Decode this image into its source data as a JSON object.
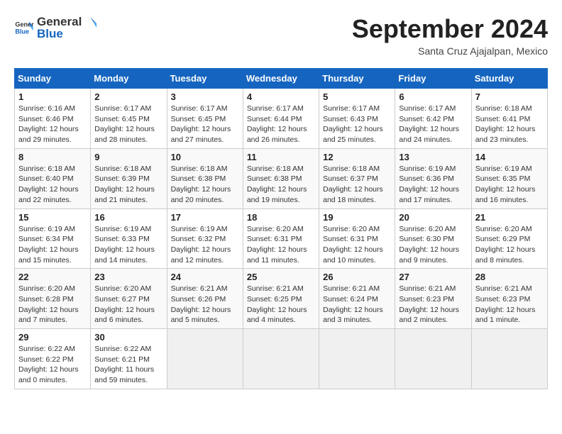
{
  "header": {
    "logo_general": "General",
    "logo_blue": "Blue",
    "month_title": "September 2024",
    "location": "Santa Cruz Ajajalpan, Mexico"
  },
  "calendar": {
    "days_of_week": [
      "Sunday",
      "Monday",
      "Tuesday",
      "Wednesday",
      "Thursday",
      "Friday",
      "Saturday"
    ],
    "weeks": [
      [
        {
          "day": "",
          "empty": true
        },
        {
          "day": "",
          "empty": true
        },
        {
          "day": "",
          "empty": true
        },
        {
          "day": "",
          "empty": true
        },
        {
          "day": "",
          "empty": true
        },
        {
          "day": "",
          "empty": true
        },
        {
          "day": "",
          "empty": true
        }
      ],
      [
        {
          "day": "1",
          "sunrise": "Sunrise: 6:16 AM",
          "sunset": "Sunset: 6:46 PM",
          "daylight": "Daylight: 12 hours and 29 minutes."
        },
        {
          "day": "2",
          "sunrise": "Sunrise: 6:17 AM",
          "sunset": "Sunset: 6:45 PM",
          "daylight": "Daylight: 12 hours and 28 minutes."
        },
        {
          "day": "3",
          "sunrise": "Sunrise: 6:17 AM",
          "sunset": "Sunset: 6:45 PM",
          "daylight": "Daylight: 12 hours and 27 minutes."
        },
        {
          "day": "4",
          "sunrise": "Sunrise: 6:17 AM",
          "sunset": "Sunset: 6:44 PM",
          "daylight": "Daylight: 12 hours and 26 minutes."
        },
        {
          "day": "5",
          "sunrise": "Sunrise: 6:17 AM",
          "sunset": "Sunset: 6:43 PM",
          "daylight": "Daylight: 12 hours and 25 minutes."
        },
        {
          "day": "6",
          "sunrise": "Sunrise: 6:17 AM",
          "sunset": "Sunset: 6:42 PM",
          "daylight": "Daylight: 12 hours and 24 minutes."
        },
        {
          "day": "7",
          "sunrise": "Sunrise: 6:18 AM",
          "sunset": "Sunset: 6:41 PM",
          "daylight": "Daylight: 12 hours and 23 minutes."
        }
      ],
      [
        {
          "day": "8",
          "sunrise": "Sunrise: 6:18 AM",
          "sunset": "Sunset: 6:40 PM",
          "daylight": "Daylight: 12 hours and 22 minutes."
        },
        {
          "day": "9",
          "sunrise": "Sunrise: 6:18 AM",
          "sunset": "Sunset: 6:39 PM",
          "daylight": "Daylight: 12 hours and 21 minutes."
        },
        {
          "day": "10",
          "sunrise": "Sunrise: 6:18 AM",
          "sunset": "Sunset: 6:38 PM",
          "daylight": "Daylight: 12 hours and 20 minutes."
        },
        {
          "day": "11",
          "sunrise": "Sunrise: 6:18 AM",
          "sunset": "Sunset: 6:38 PM",
          "daylight": "Daylight: 12 hours and 19 minutes."
        },
        {
          "day": "12",
          "sunrise": "Sunrise: 6:18 AM",
          "sunset": "Sunset: 6:37 PM",
          "daylight": "Daylight: 12 hours and 18 minutes."
        },
        {
          "day": "13",
          "sunrise": "Sunrise: 6:19 AM",
          "sunset": "Sunset: 6:36 PM",
          "daylight": "Daylight: 12 hours and 17 minutes."
        },
        {
          "day": "14",
          "sunrise": "Sunrise: 6:19 AM",
          "sunset": "Sunset: 6:35 PM",
          "daylight": "Daylight: 12 hours and 16 minutes."
        }
      ],
      [
        {
          "day": "15",
          "sunrise": "Sunrise: 6:19 AM",
          "sunset": "Sunset: 6:34 PM",
          "daylight": "Daylight: 12 hours and 15 minutes."
        },
        {
          "day": "16",
          "sunrise": "Sunrise: 6:19 AM",
          "sunset": "Sunset: 6:33 PM",
          "daylight": "Daylight: 12 hours and 14 minutes."
        },
        {
          "day": "17",
          "sunrise": "Sunrise: 6:19 AM",
          "sunset": "Sunset: 6:32 PM",
          "daylight": "Daylight: 12 hours and 12 minutes."
        },
        {
          "day": "18",
          "sunrise": "Sunrise: 6:20 AM",
          "sunset": "Sunset: 6:31 PM",
          "daylight": "Daylight: 12 hours and 11 minutes."
        },
        {
          "day": "19",
          "sunrise": "Sunrise: 6:20 AM",
          "sunset": "Sunset: 6:31 PM",
          "daylight": "Daylight: 12 hours and 10 minutes."
        },
        {
          "day": "20",
          "sunrise": "Sunrise: 6:20 AM",
          "sunset": "Sunset: 6:30 PM",
          "daylight": "Daylight: 12 hours and 9 minutes."
        },
        {
          "day": "21",
          "sunrise": "Sunrise: 6:20 AM",
          "sunset": "Sunset: 6:29 PM",
          "daylight": "Daylight: 12 hours and 8 minutes."
        }
      ],
      [
        {
          "day": "22",
          "sunrise": "Sunrise: 6:20 AM",
          "sunset": "Sunset: 6:28 PM",
          "daylight": "Daylight: 12 hours and 7 minutes."
        },
        {
          "day": "23",
          "sunrise": "Sunrise: 6:20 AM",
          "sunset": "Sunset: 6:27 PM",
          "daylight": "Daylight: 12 hours and 6 minutes."
        },
        {
          "day": "24",
          "sunrise": "Sunrise: 6:21 AM",
          "sunset": "Sunset: 6:26 PM",
          "daylight": "Daylight: 12 hours and 5 minutes."
        },
        {
          "day": "25",
          "sunrise": "Sunrise: 6:21 AM",
          "sunset": "Sunset: 6:25 PM",
          "daylight": "Daylight: 12 hours and 4 minutes."
        },
        {
          "day": "26",
          "sunrise": "Sunrise: 6:21 AM",
          "sunset": "Sunset: 6:24 PM",
          "daylight": "Daylight: 12 hours and 3 minutes."
        },
        {
          "day": "27",
          "sunrise": "Sunrise: 6:21 AM",
          "sunset": "Sunset: 6:23 PM",
          "daylight": "Daylight: 12 hours and 2 minutes."
        },
        {
          "day": "28",
          "sunrise": "Sunrise: 6:21 AM",
          "sunset": "Sunset: 6:23 PM",
          "daylight": "Daylight: 12 hours and 1 minute."
        }
      ],
      [
        {
          "day": "29",
          "sunrise": "Sunrise: 6:22 AM",
          "sunset": "Sunset: 6:22 PM",
          "daylight": "Daylight: 12 hours and 0 minutes."
        },
        {
          "day": "30",
          "sunrise": "Sunrise: 6:22 AM",
          "sunset": "Sunset: 6:21 PM",
          "daylight": "Daylight: 11 hours and 59 minutes."
        },
        {
          "day": "",
          "empty": true
        },
        {
          "day": "",
          "empty": true
        },
        {
          "day": "",
          "empty": true
        },
        {
          "day": "",
          "empty": true
        },
        {
          "day": "",
          "empty": true
        }
      ]
    ]
  }
}
